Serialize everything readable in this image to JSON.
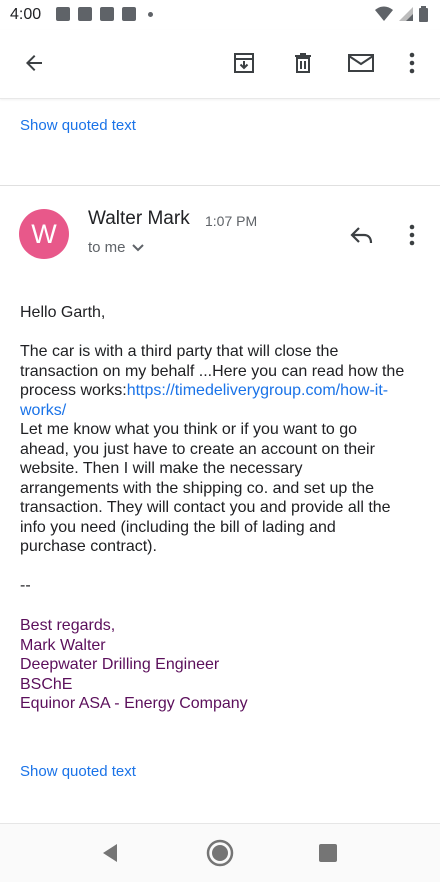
{
  "status_bar": {
    "time": "4:00"
  },
  "toolbar": {
    "back": "back-arrow-icon",
    "archive": "archive-icon",
    "delete": "delete-icon",
    "mark_unread": "mail-icon",
    "more": "more-vert-icon"
  },
  "quoted_top": "Show quoted text",
  "message": {
    "avatar_letter": "W",
    "avatar_color": "#e8588a",
    "sender": "Walter Mark",
    "time": "1:07 PM",
    "recipient": "to me",
    "greeting": "Hello Garth,",
    "para1_line1": "The car is with a third party that will close the",
    "para1_line2": "transaction on my behalf ...Here you can read how the",
    "para1_line3_prefix": "process works:",
    "para1_link_part1": "https://timedeliverygroup.com/how-it-",
    "para1_link_part2": "works/",
    "para2_line1": "Let me know what you think or if you want to go",
    "para2_line2": "ahead, you just have to create an account on their",
    "para2_line3": "website. Then I will make the necessary",
    "para2_line4": "arrangements with the shipping co. and set up the",
    "para2_line5": "transaction. They will contact you and provide all the",
    "para2_line6": "info you need (including the bill of lading and",
    "para2_line7": "purchase contract).",
    "separator": "--",
    "signature": {
      "line1": "Best regards,",
      "line2": "Mark Walter",
      "line3": "Deepwater Drilling Engineer",
      "line4": "BSChE",
      "line5": "Equinor ASA - Energy Company"
    },
    "signature_color": "#5b0f5b"
  },
  "quoted_bottom": "Show quoted text",
  "colors": {
    "link": "#1a73e8",
    "text": "#202124",
    "secondary": "#5f6368"
  }
}
